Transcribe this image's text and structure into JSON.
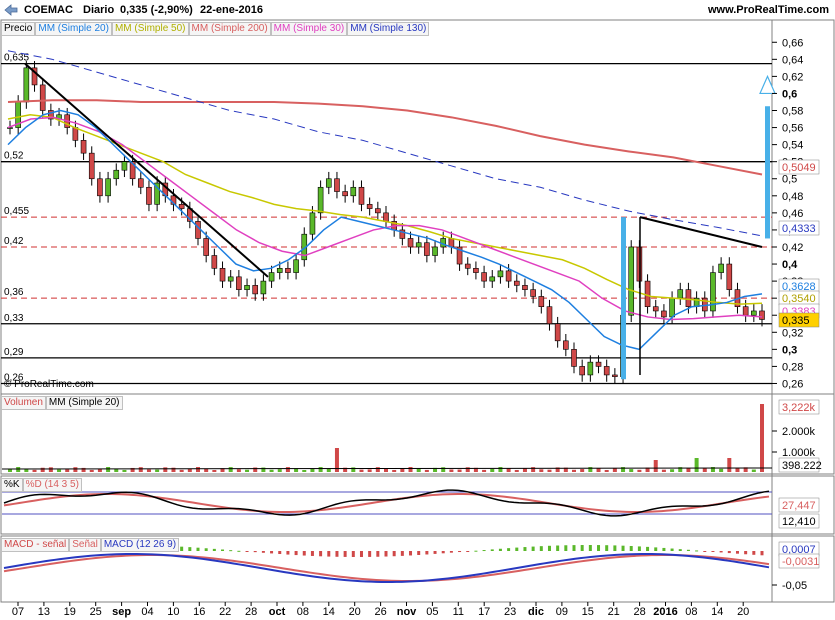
{
  "toolbar": {
    "title": "COEMAC",
    "period": "Diario",
    "price": "0,335 (-2,90%)",
    "date": "22-ene-2016",
    "site": "www.ProRealTime.com"
  },
  "panels": {
    "price": {
      "legend": [
        "Precio",
        "MM (Simple 20)",
        "MM (Simple 50)",
        "MM (Simple 200)",
        "MM (Simple 30)",
        "MM (Simple 130)"
      ],
      "watermark": "© ProRealTime.com",
      "level_labels": [
        "0,635",
        "0,52",
        "0,455",
        "0,42",
        "0,36",
        "0,33",
        "0,29",
        "0,26"
      ],
      "price_tags": [
        "0,5049",
        "0,4333",
        "0,3628",
        "0,3540",
        "0,3383",
        "0,335"
      ]
    },
    "volume": {
      "legend": [
        "Volumen",
        "MM (Simple 20)"
      ],
      "tags": [
        "3,222k",
        "398.222"
      ]
    },
    "stochastic": {
      "legend": [
        "%K",
        "%D (14 3 5)"
      ],
      "tags": [
        "27,447",
        "12,410"
      ]
    },
    "macd": {
      "legend": [
        "MACD - señal",
        "Señal",
        "MACD (12 26 9)"
      ],
      "tags": [
        "0,0007",
        "-0,0031"
      ]
    }
  },
  "colors": {
    "sma20": "#1e7fe0",
    "sma50": "#c8c800",
    "sma200": "#d86060",
    "sma30": "#e040c0",
    "sma130": "#2838c0",
    "up": "#5ab82a",
    "down": "#d04848",
    "arrow": "#48b0e8"
  },
  "chart_data": [
    {
      "type": "candlestick",
      "title": "COEMAC Diario",
      "x_ticks": [
        "07",
        "13",
        "19",
        "25",
        "sep",
        "04",
        "10",
        "16",
        "22",
        "28",
        "oct",
        "08",
        "14",
        "20",
        "26",
        "nov",
        "05",
        "11",
        "17",
        "23",
        "dic",
        "09",
        "15",
        "21",
        "28",
        "2016",
        "08",
        "14",
        "20"
      ],
      "y_ticks": [
        "0,66",
        "0,64",
        "0,62",
        "0,6",
        "0,58",
        "0,56",
        "0,54",
        "0,52",
        "0,5",
        "0,48",
        "0,46",
        "0,44",
        "0,42",
        "0,4",
        "0,38",
        "0,36",
        "0,34",
        "0,32",
        "0,3",
        "0,28",
        "0,26"
      ],
      "ylim": [
        0.25,
        0.665
      ],
      "horizontal_levels": {
        "solid": [
          0.635,
          0.52,
          0.33,
          0.29,
          0.26
        ],
        "dashed": [
          0.455,
          0.42,
          0.36
        ]
      },
      "close_series": [
        0.56,
        0.59,
        0.63,
        0.61,
        0.58,
        0.57,
        0.575,
        0.56,
        0.545,
        0.53,
        0.5,
        0.48,
        0.5,
        0.51,
        0.52,
        0.5,
        0.49,
        0.47,
        0.495,
        0.48,
        0.47,
        0.465,
        0.45,
        0.43,
        0.41,
        0.395,
        0.38,
        0.385,
        0.37,
        0.375,
        0.365,
        0.38,
        0.39,
        0.395,
        0.39,
        0.405,
        0.435,
        0.46,
        0.49,
        0.5,
        0.485,
        0.48,
        0.49,
        0.47,
        0.465,
        0.46,
        0.45,
        0.44,
        0.43,
        0.42,
        0.425,
        0.41,
        0.42,
        0.43,
        0.42,
        0.4,
        0.395,
        0.39,
        0.38,
        0.385,
        0.392,
        0.38,
        0.375,
        0.37,
        0.362,
        0.35,
        0.33,
        0.31,
        0.3,
        0.28,
        0.27,
        0.285,
        0.28,
        0.27,
        0.268,
        0.34,
        0.42,
        0.38,
        0.35,
        0.345,
        0.338,
        0.36,
        0.37,
        0.35,
        0.36,
        0.345,
        0.39,
        0.4,
        0.37,
        0.35,
        0.34,
        0.345,
        0.335
      ],
      "moving_averages": {
        "sma20": [
          0.54,
          0.56,
          0.575,
          0.58,
          0.575,
          0.56,
          0.54,
          0.52,
          0.5,
          0.48,
          0.46,
          0.44,
          0.42,
          0.4,
          0.392,
          0.395,
          0.405,
          0.42,
          0.44,
          0.455,
          0.45,
          0.445,
          0.44,
          0.435,
          0.43,
          0.422,
          0.415,
          0.408,
          0.4,
          0.39,
          0.38,
          0.37,
          0.355,
          0.335,
          0.315,
          0.305,
          0.3,
          0.32,
          0.34,
          0.35,
          0.352,
          0.355,
          0.362,
          0.365
        ],
        "sma50": [
          0.57,
          0.575,
          0.572,
          0.56,
          0.55,
          0.54,
          0.53,
          0.52,
          0.505,
          0.495,
          0.485,
          0.478,
          0.47,
          0.465,
          0.462,
          0.458,
          0.455,
          0.45,
          0.445,
          0.438,
          0.43,
          0.425,
          0.42,
          0.415,
          0.41,
          0.405,
          0.395,
          0.382,
          0.37,
          0.362,
          0.36,
          0.358,
          0.355,
          0.353,
          0.354
        ],
        "sma200": [
          0.59,
          0.592,
          0.592,
          0.59,
          0.59,
          0.59,
          0.59,
          0.588,
          0.585,
          0.58,
          0.572,
          0.562,
          0.55,
          0.54,
          0.532,
          0.525,
          0.515,
          0.505
        ],
        "sma30": [
          0.56,
          0.57,
          0.572,
          0.565,
          0.555,
          0.54,
          0.52,
          0.5,
          0.48,
          0.46,
          0.44,
          0.425,
          0.415,
          0.41,
          0.42,
          0.43,
          0.44,
          0.445,
          0.445,
          0.44,
          0.43,
          0.42,
          0.41,
          0.4,
          0.39,
          0.38,
          0.36,
          0.345,
          0.338,
          0.335,
          0.336,
          0.338,
          0.34,
          0.338
        ],
        "sma130": [
          0.65,
          0.64,
          0.625,
          0.61,
          0.595,
          0.58,
          0.57,
          0.555,
          0.545,
          0.53,
          0.515,
          0.5,
          0.49,
          0.475,
          0.462,
          0.452,
          0.443,
          0.433
        ]
      },
      "last_values": {
        "close": 0.335,
        "sma200": 0.5049,
        "sma130": 0.4333,
        "sma20": 0.3628,
        "sma50": 0.354,
        "sma30": 0.3383
      }
    },
    {
      "type": "bar",
      "title": "Volumen",
      "y_ticks": [
        "2.000k",
        "1.000k"
      ],
      "last_volume": 3222000,
      "sma20_volume": 398222
    },
    {
      "type": "line",
      "title": "%K %D (14 3 5)",
      "series": [
        {
          "name": "%K",
          "last": 12.41
        },
        {
          "name": "%D",
          "last": 27.447
        }
      ]
    },
    {
      "type": "line",
      "title": "MACD (12 26 9)",
      "y_ticks": [
        "-0,05"
      ],
      "series": [
        {
          "name": "MACD",
          "last": -0.0031
        },
        {
          "name": "Señal",
          "last": 0.0007
        }
      ]
    }
  ]
}
